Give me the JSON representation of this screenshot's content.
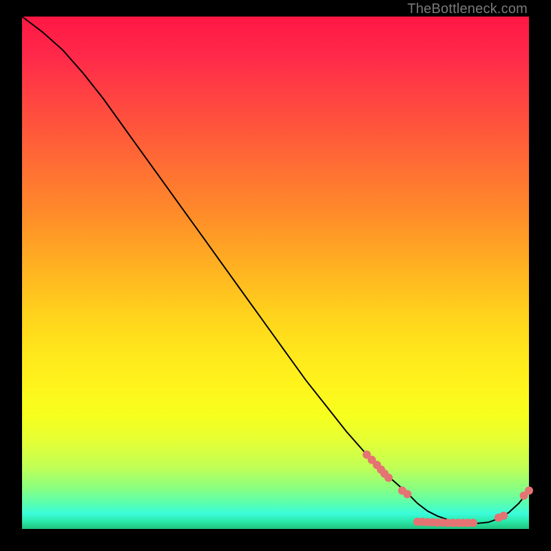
{
  "watermark": "TheBottleneck.com",
  "colors": {
    "scatter_point": "#e57373",
    "curve": "#000000",
    "frame_bg": "#000000"
  },
  "chart_data": {
    "type": "line",
    "title": "",
    "xlabel": "",
    "ylabel": "",
    "xlim": [
      0,
      100
    ],
    "ylim": [
      0,
      100
    ],
    "curve": {
      "x": [
        0,
        4,
        8,
        12,
        16,
        20,
        24,
        28,
        32,
        36,
        40,
        44,
        48,
        52,
        56,
        60,
        64,
        68,
        72,
        76,
        78,
        80,
        82,
        84,
        86,
        88,
        90,
        92,
        94,
        96,
        98,
        100
      ],
      "y": [
        100,
        97,
        93.5,
        89,
        84,
        78.5,
        73,
        67.5,
        62,
        56.5,
        51,
        45.5,
        40,
        34.5,
        29,
        24,
        19,
        14.5,
        10.5,
        7,
        5,
        3.5,
        2.5,
        1.8,
        1.4,
        1.2,
        1.1,
        1.3,
        2,
        3.2,
        5,
        7.5
      ]
    },
    "scatter": [
      {
        "x": 68,
        "y": 14.5
      },
      {
        "x": 69,
        "y": 13.5
      },
      {
        "x": 70,
        "y": 12.5
      },
      {
        "x": 70.8,
        "y": 11.6
      },
      {
        "x": 71.5,
        "y": 10.8
      },
      {
        "x": 72.3,
        "y": 10
      },
      {
        "x": 75,
        "y": 7.5
      },
      {
        "x": 76,
        "y": 6.8
      },
      {
        "x": 78,
        "y": 1.4
      },
      {
        "x": 79,
        "y": 1.4
      },
      {
        "x": 80,
        "y": 1.3
      },
      {
        "x": 81,
        "y": 1.3
      },
      {
        "x": 82,
        "y": 1.25
      },
      {
        "x": 83,
        "y": 1.25
      },
      {
        "x": 84,
        "y": 1.2
      },
      {
        "x": 85,
        "y": 1.2
      },
      {
        "x": 86,
        "y": 1.2
      },
      {
        "x": 87,
        "y": 1.2
      },
      {
        "x": 88,
        "y": 1.2
      },
      {
        "x": 89,
        "y": 1.2
      },
      {
        "x": 94,
        "y": 2.2
      },
      {
        "x": 95,
        "y": 2.6
      },
      {
        "x": 99,
        "y": 6.5
      },
      {
        "x": 100,
        "y": 7.5
      }
    ]
  }
}
